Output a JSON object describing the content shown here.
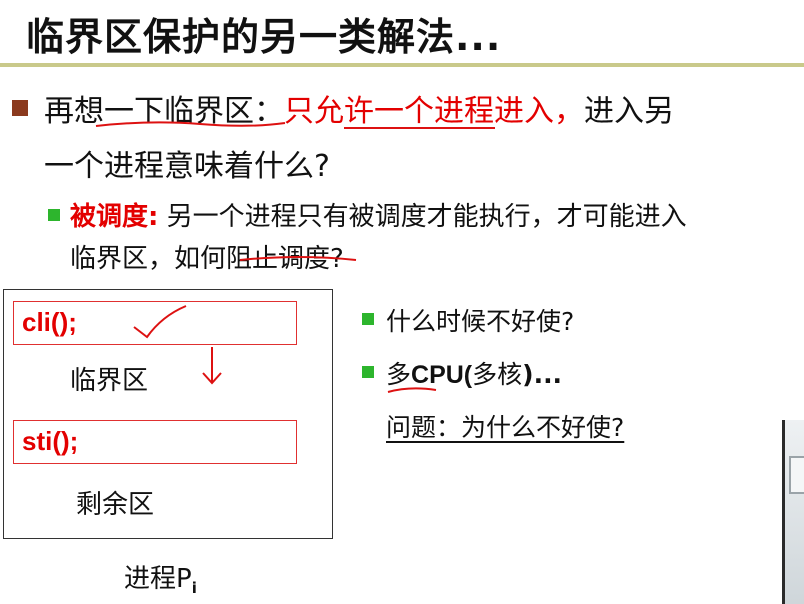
{
  "slide": {
    "title": "临界区保护的另一类解法...",
    "bullet1": {
      "part1": "再想一下临界区：",
      "part2_red": "只允许一个进程进入，",
      "part3": "进入另",
      "line2": "一个进程意味着什么?"
    },
    "bullet2": {
      "label_red": "被调度:",
      "text1": " 另一个进程只有被调度才能执行，才可能进入",
      "text2": "临界区，如何阻止调度?"
    },
    "diagram": {
      "cli": "cli();",
      "critical": "临界区",
      "sti": "sti();",
      "remainder": "剩余区",
      "process_label": "进程P",
      "process_sub": "i"
    },
    "right_bullets": {
      "q1": "什么时候不好使?",
      "q2_pre": "多",
      "q2_cpu": "CPU(",
      "q2_mid": "多核",
      "q2_end": ")...",
      "q3": "问题：为什么不好使?"
    }
  },
  "colors": {
    "title_rule": "#c9c98a",
    "bullet_main": "#8b3a1e",
    "bullet_sub": "#2db52d",
    "accent_red": "#e30000"
  }
}
